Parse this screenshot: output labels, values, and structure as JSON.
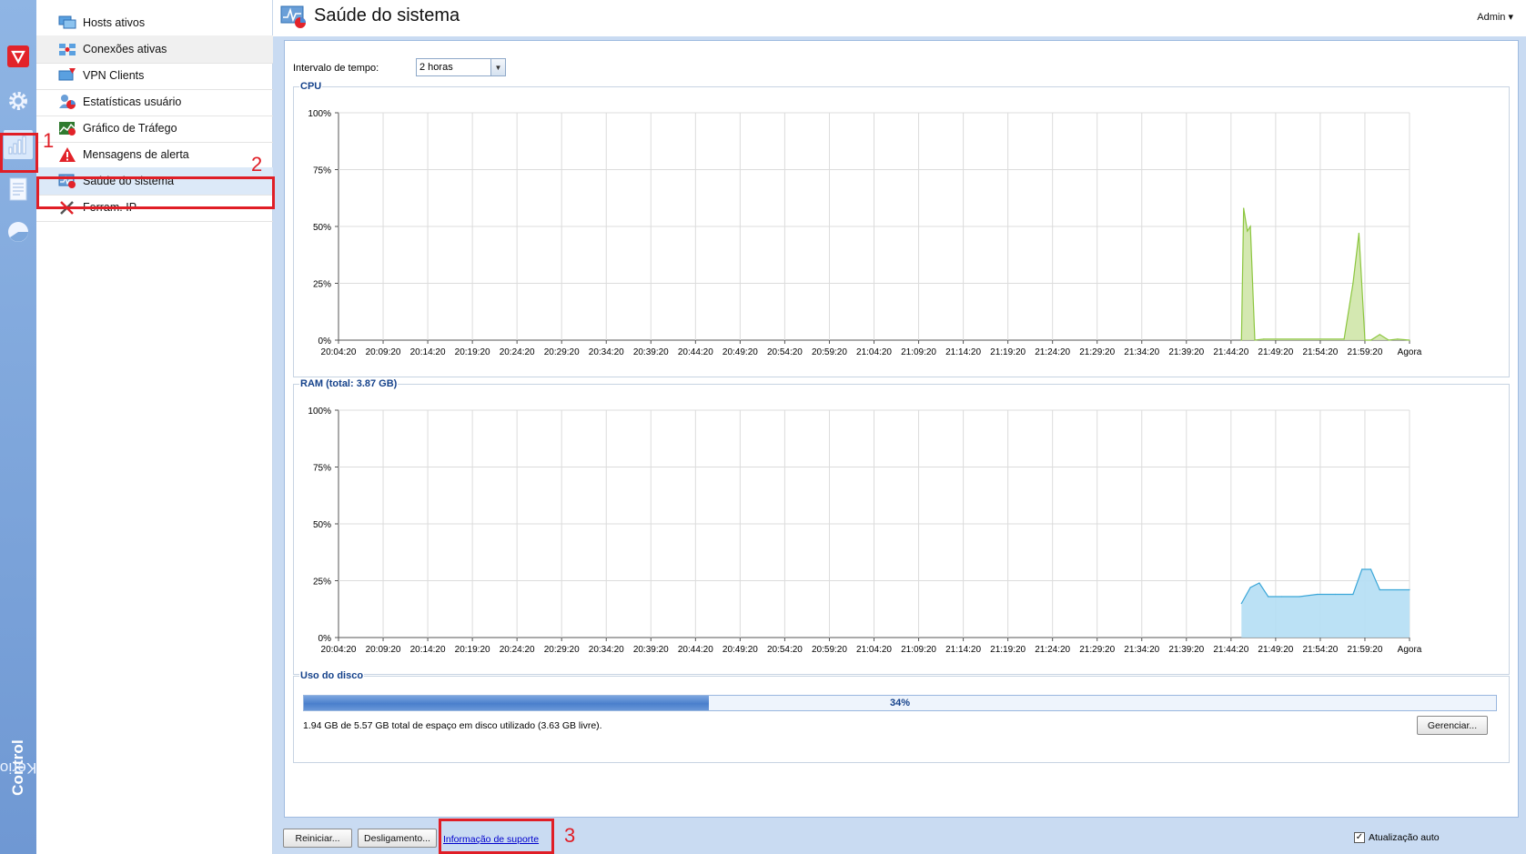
{
  "app": {
    "brand_light": "Kerio",
    "brand_bold": "Control"
  },
  "rail": [
    {
      "icon": "kerio-shield-icon"
    },
    {
      "icon": "gear-icon"
    },
    {
      "icon": "status-chart-icon"
    },
    {
      "icon": "logs-icon"
    },
    {
      "icon": "pie-chart-icon"
    }
  ],
  "nav": {
    "items": [
      {
        "label": "Hosts ativos",
        "icon": "active-hosts-icon"
      },
      {
        "label": "Conexões ativas",
        "icon": "active-connections-icon"
      },
      {
        "label": "VPN Clients",
        "icon": "vpn-clients-icon"
      },
      {
        "label": "Estatísticas usuário",
        "icon": "user-statistics-icon"
      },
      {
        "label": "Gráfico de Tráfego",
        "icon": "traffic-chart-icon"
      },
      {
        "label": "Mensagens de alerta",
        "icon": "alert-warning-icon"
      },
      {
        "label": "Saúde do sistema",
        "icon": "system-health-icon"
      },
      {
        "label": "Ferram. IP",
        "icon": "ip-tools-icon"
      }
    ],
    "selected_index": 6
  },
  "header": {
    "title": "Saúde do sistema",
    "user": "Admin ▾"
  },
  "interval": {
    "label": "Intervalo de tempo:",
    "value": "2 horas"
  },
  "x_labels": [
    "20:04:20",
    "20:09:20",
    "20:14:20",
    "20:19:20",
    "20:24:20",
    "20:29:20",
    "20:34:20",
    "20:39:20",
    "20:44:20",
    "20:49:20",
    "20:54:20",
    "20:59:20",
    "21:04:20",
    "21:09:20",
    "21:14:20",
    "21:19:20",
    "21:24:20",
    "21:29:20",
    "21:34:20",
    "21:39:20",
    "21:44:20",
    "21:49:20",
    "21:54:20",
    "21:59:20",
    "Agora"
  ],
  "y_labels": [
    "100%",
    "75%",
    "50%",
    "25%",
    "0%"
  ],
  "cpu": {
    "legend": "CPU"
  },
  "ram": {
    "legend": "RAM (total: 3.87 GB)"
  },
  "chart_data": [
    {
      "type": "area",
      "ylim": [
        0,
        100
      ],
      "color": "#8cc63f",
      "fill": "#cfe6a8",
      "x": [
        "21:45:30",
        "21:45:45",
        "21:46:10",
        "21:46:30",
        "21:47:00",
        "21:48:00",
        "21:57:00",
        "21:58:00",
        "21:58:40",
        "21:59:20",
        "22:00:00",
        "22:01:00",
        "22:02:00",
        "22:03:00",
        "22:04:20"
      ],
      "values": [
        0,
        58,
        48,
        50,
        0,
        0.5,
        0.5,
        25,
        47,
        0,
        0,
        2.5,
        0,
        0.5,
        0
      ]
    },
    {
      "type": "area",
      "ylim": [
        0,
        100
      ],
      "color": "#3aa6d8",
      "fill": "#b4def4",
      "x": [
        "21:45:30",
        "21:46:30",
        "21:47:30",
        "21:48:30",
        "21:50:00",
        "21:52:00",
        "21:54:00",
        "21:56:00",
        "21:58:00",
        "21:59:00",
        "22:00:00",
        "22:01:00",
        "22:04:20"
      ],
      "values": [
        15,
        22,
        24,
        18,
        18,
        18,
        19,
        19,
        19,
        30,
        30,
        21,
        21
      ]
    }
  ],
  "disk": {
    "legend": "Uso do disco",
    "percent": 34,
    "percent_label": "34%",
    "summary": "1.94 GB de 5.57 GB total de espaço em disco utilizado (3.63 GB livre).",
    "manage_label": "Gerenciar..."
  },
  "footer": {
    "restart_label": "Reiniciar...",
    "shutdown_label": "Desligamento...",
    "support_label": "Informação de suporte",
    "auto_label": "Atualização auto",
    "auto_checked": true
  },
  "annotations": [
    "1",
    "2",
    "3"
  ]
}
